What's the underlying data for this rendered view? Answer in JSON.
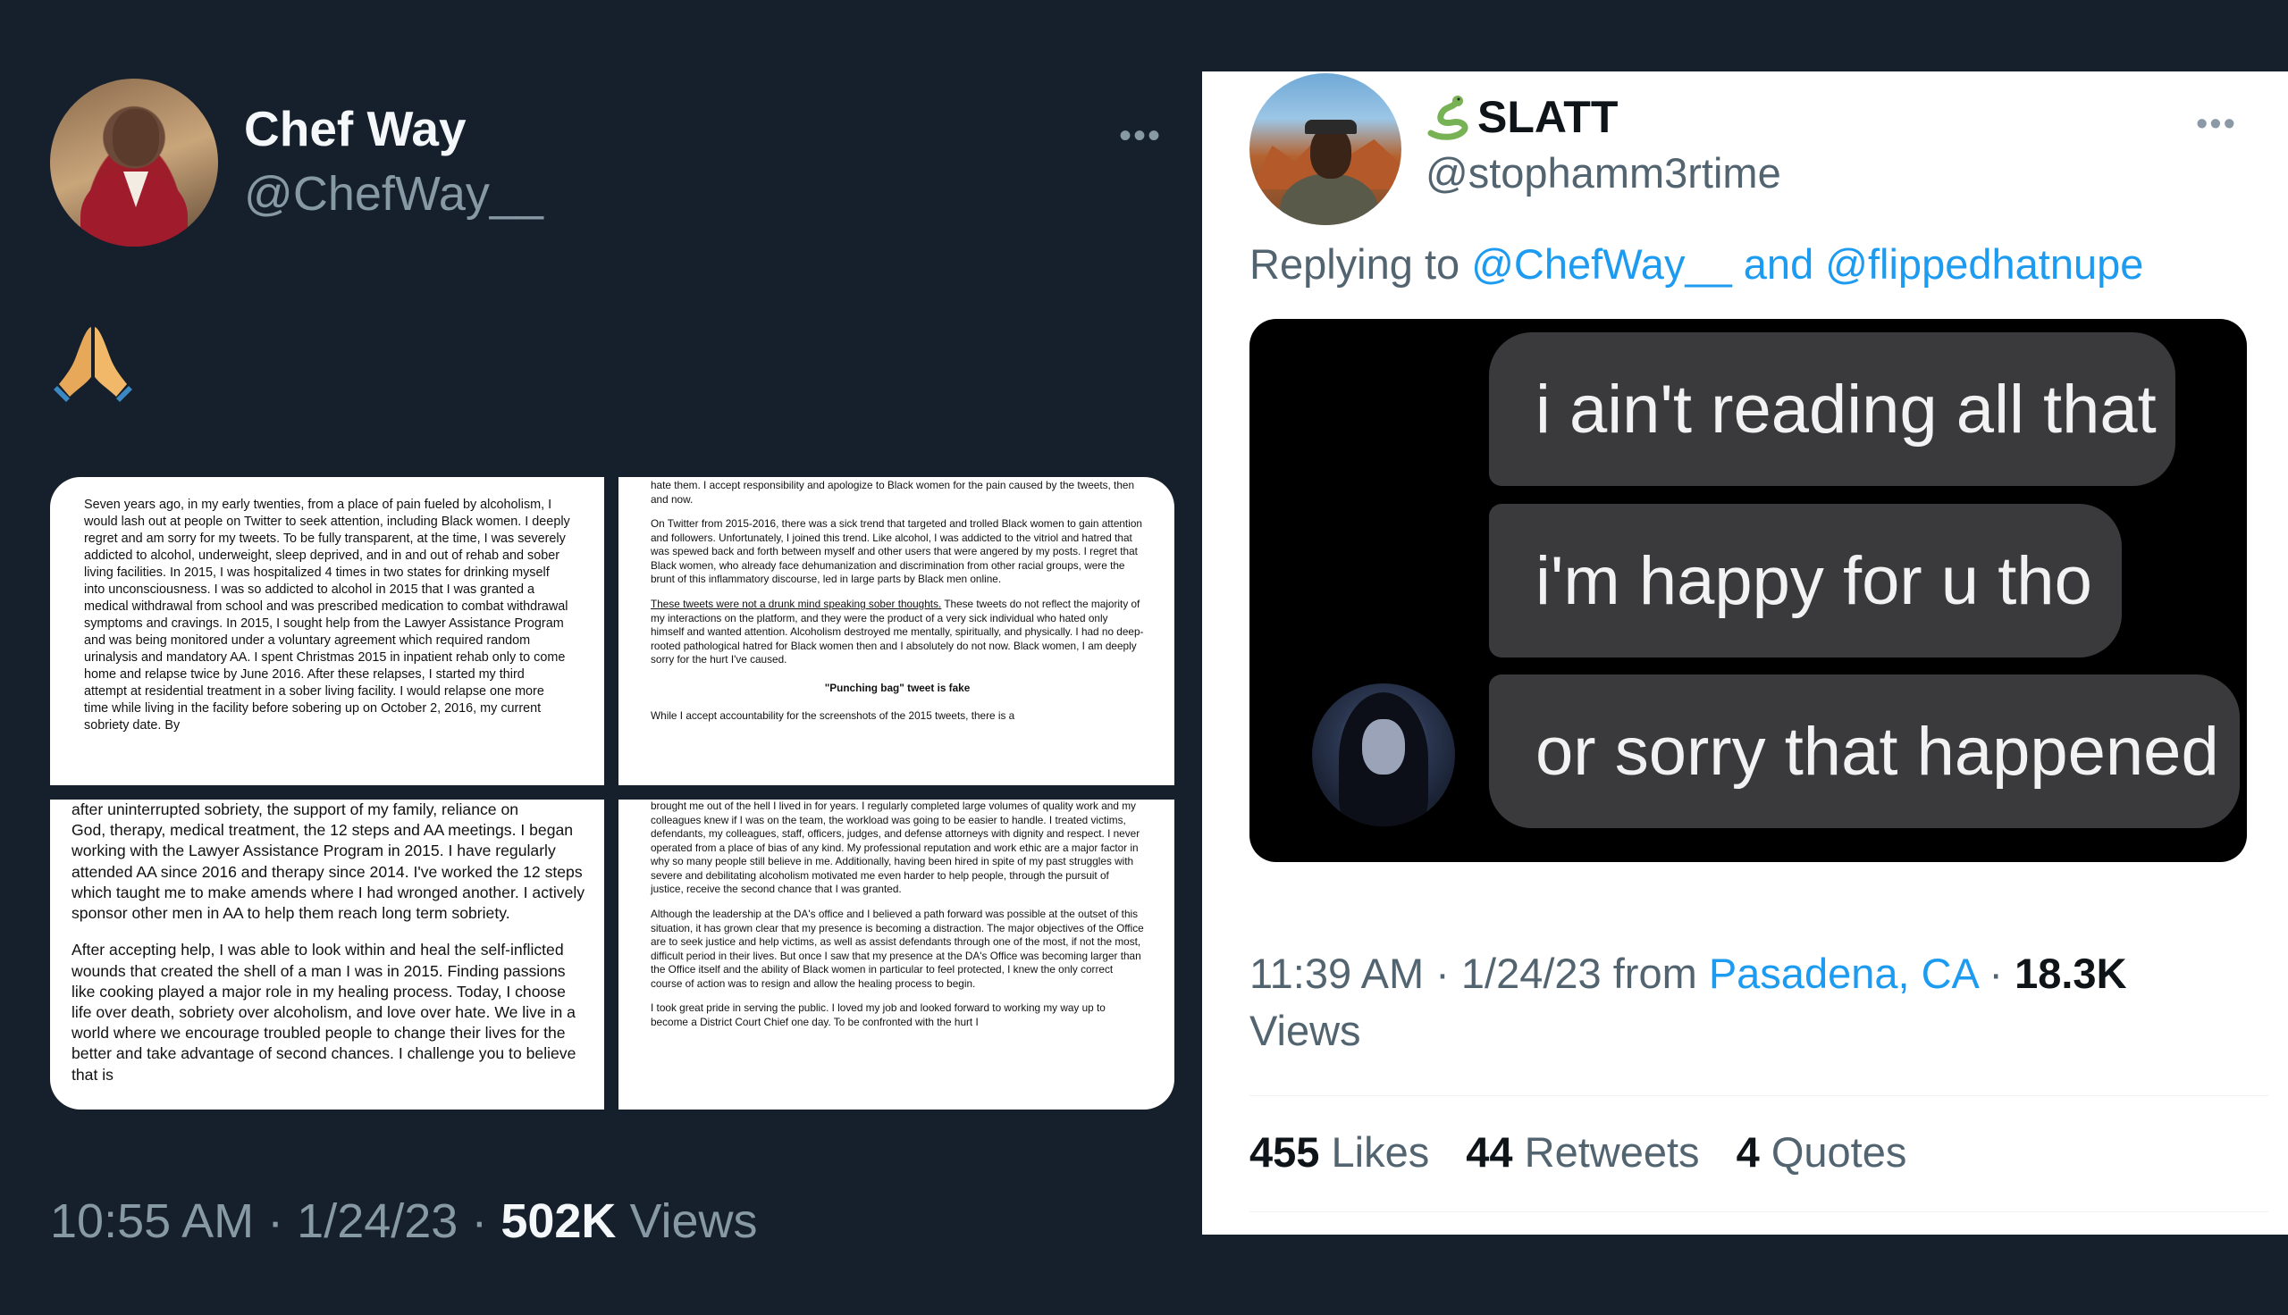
{
  "left_tweet": {
    "display_name": "Chef Way",
    "handle": "@ChefWay__",
    "more": "•••",
    "emoji_name": "folded-hands",
    "doc_panels": {
      "panel1": "Seven years ago, in my early twenties, from a place of pain fueled by alcoholism, I would lash out at people on Twitter to seek attention, including Black women. I deeply regret and am sorry for my tweets. To be fully transparent, at the time, I was severely addicted to alcohol, underweight, sleep deprived, and in and out of rehab and sober living facilities. In 2015, I was hospitalized 4 times in two states for drinking myself into unconsciousness. I was so addicted to alcohol in 2015 that I was granted a medical withdrawal from school and was prescribed medication to combat withdrawal symptoms and cravings. In 2015, I sought help from the Lawyer Assistance Program and was being monitored under a voluntary agreement which required random urinalysis and mandatory AA. I spent Christmas 2015 in inpatient rehab only to come home and relapse twice by June 2016. After these relapses, I started my third attempt at residential treatment in a sober living facility. I would relapse one more time while living in the facility before sobering up on October 2, 2016, my current sobriety date. By",
      "panel2_p1": "hate them. I accept responsibility and apologize to Black women for the pain caused by the tweets, then and now.",
      "panel2_p2": "On Twitter from 2015-2016, there was a sick trend that targeted and trolled Black women to gain attention and followers. Unfortunately, I joined this trend. Like alcohol, I was addicted to the vitriol and hatred that was spewed back and forth between myself and other users that were angered by my posts. I regret that Black women, who already face dehumanization and discrimination from other racial groups, were the brunt of this inflammatory discourse, led in large parts by Black men online.",
      "panel2_p3_underlined": "These tweets were not a drunk mind speaking sober thoughts.",
      "panel2_p3_rest": " These tweets do not reflect the majority of my interactions on the platform, and they were the product of a very sick individual who hated only himself and wanted attention. Alcoholism destroyed me mentally, spiritually, and physically. I had no deep-rooted pathological hatred for Black women then and I absolutely do not now. Black women, I am deeply sorry for the hurt I've caused.",
      "panel2_heading": "\"Punching bag\" tweet is fake",
      "panel2_p4": "While I accept accountability for the screenshots of the 2015 tweets, there is a",
      "panel3_cut": "after uninterrupted sobriety, the support of my family, reliance on",
      "panel3_p1": "God, therapy, medical treatment, the 12 steps and AA meetings. I began working with the Lawyer Assistance Program in 2015. I have regularly attended AA since 2016 and therapy since 2014. I've worked the 12 steps which taught me to make amends where I had wronged another. I actively sponsor other men in AA to help them reach long term sobriety.",
      "panel3_p2": "After accepting help, I was able to look within and heal the self-inflicted wounds that created the shell of a man I was in 2015. Finding passions like cooking played a major role in my healing process. Today, I choose life over death, sobriety over alcoholism, and love over hate. We live in a world where we encourage troubled people to change their lives for the better and take advantage of second chances. I challenge you to believe that is",
      "panel4_p1": "brought me out of the hell I lived in for years. I regularly completed large volumes of quality work and my colleagues knew if I was on the team, the workload was going to be easier to handle. I treated victims, defendants, my colleagues, staff, officers, judges, and defense attorneys with dignity and respect. I never operated from a place of bias of any kind. My professional reputation and work ethic are a major factor in why so many people still believe in me. Additionally, having been hired in spite of my past struggles with severe and debilitating alcoholism motivated me even harder to help people, through the pursuit of justice, receive the second chance that I was granted.",
      "panel4_p2": "Although the leadership at the DA's office and I believed a path forward was possible at the outset of this situation, it has grown clear that my presence is becoming a distraction. The major objectives of the Office are to seek justice and help victims, as well as assist defendants through one of the most, if not the most, difficult period in their lives. But once I saw that my presence at the DA's Office was becoming larger than the Office itself and the ability of Black women in particular to feel protected, I knew the only correct course of action was to resign and allow the healing process to begin.",
      "panel4_p3": "I took great pride in serving the public. I loved my job and looked forward to working my way up to become a District Court Chief one day. To be confronted with the hurt I"
    },
    "time": "10:55 AM",
    "date": "1/24/23",
    "views_count": "502K",
    "views_label": "Views",
    "separator": " · "
  },
  "right_tweet": {
    "display_name": "SLATT",
    "name_emoji": "snake",
    "handle": "@stophamm3rtime",
    "more": "•••",
    "replying_to_prefix": "Replying to ",
    "reply_mention1": "@ChefWay__",
    "reply_and": " and ",
    "reply_mention2": "@flippedhatnupe",
    "meme_bubbles": [
      "i ain't reading all that",
      "i'm happy for u tho",
      "or sorry that happened"
    ],
    "time": "11:39 AM",
    "date": "1/24/23",
    "from_label": "from",
    "location": "Pasadena, CA",
    "views_count": "18.3K",
    "views_label": "Views",
    "separator": " · ",
    "stats": [
      {
        "count": "455",
        "label": "Likes"
      },
      {
        "count": "44",
        "label": "Retweets"
      },
      {
        "count": "4",
        "label": "Quotes"
      }
    ]
  },
  "colors": {
    "dark_bg": "#16202c",
    "light_bg": "#ffffff",
    "link_blue": "#1d9bf0",
    "muted_dark": "#8899a6",
    "muted_light": "#536471"
  }
}
